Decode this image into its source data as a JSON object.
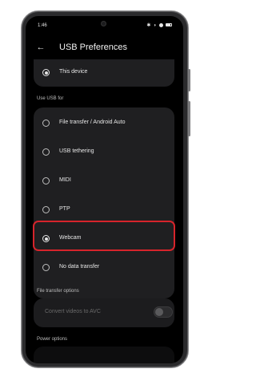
{
  "status_bar": {
    "time": "1:46"
  },
  "header": {
    "title": "USB Preferences"
  },
  "top_option": {
    "label": "This device",
    "selected": true
  },
  "use_usb_for": {
    "section_label": "Use USB for",
    "options": [
      {
        "label": "File transfer / Android Auto",
        "selected": false
      },
      {
        "label": "USB tethering",
        "selected": false
      },
      {
        "label": "MIDI",
        "selected": false
      },
      {
        "label": "PTP",
        "selected": false
      },
      {
        "label": "Webcam",
        "selected": true
      },
      {
        "label": "No data transfer",
        "selected": false
      }
    ]
  },
  "file_transfer_options": {
    "section_label": "File transfer options",
    "convert_label": "Convert videos to AVC",
    "convert_enabled": false
  },
  "power_options": {
    "section_label": "Power options"
  },
  "colors": {
    "highlight": "#d6242b",
    "background": "#000000",
    "card": "#1f1f21"
  }
}
